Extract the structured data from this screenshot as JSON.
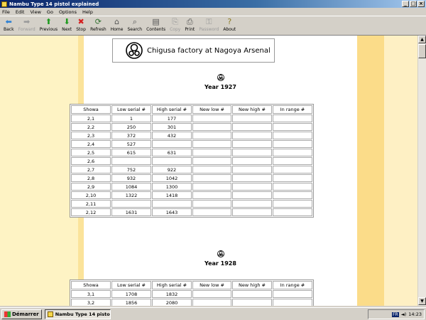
{
  "window": {
    "title": "Nambu Type 14 pistol explained"
  },
  "menu": [
    "File",
    "Edit",
    "View",
    "Go",
    "Options",
    "Help"
  ],
  "toolbar": [
    {
      "label": "Back",
      "icon": "back-arrow-icon",
      "glyph": "⬅",
      "color": "#2a7fd4",
      "enabled": true
    },
    {
      "label": "Forward",
      "icon": "forward-arrow-icon",
      "glyph": "➡",
      "color": "#9a9a9a",
      "enabled": false
    },
    {
      "label": "Previous",
      "icon": "up-arrow-icon",
      "glyph": "⬆",
      "color": "#1e9a1e",
      "enabled": true
    },
    {
      "label": "Next",
      "icon": "down-arrow-icon",
      "glyph": "⬇",
      "color": "#1e9a1e",
      "enabled": true
    },
    {
      "label": "Stop",
      "icon": "stop-icon",
      "glyph": "✖",
      "color": "#d42020",
      "enabled": true
    },
    {
      "label": "Refresh",
      "icon": "refresh-icon",
      "glyph": "⟳",
      "color": "#2f6f2f",
      "enabled": true
    },
    {
      "label": "Home",
      "icon": "home-icon",
      "glyph": "⌂",
      "color": "#555555",
      "enabled": true
    },
    {
      "label": "Search",
      "icon": "search-icon",
      "glyph": "⌕",
      "color": "#555555",
      "enabled": true
    },
    {
      "label": "Contents",
      "icon": "contents-icon",
      "glyph": "▤",
      "color": "#555555",
      "enabled": true
    },
    {
      "label": "Copy",
      "icon": "copy-icon",
      "glyph": "⎘",
      "color": "#9a9a9a",
      "enabled": false
    },
    {
      "label": "Print",
      "icon": "print-icon",
      "glyph": "⎙",
      "color": "#555555",
      "enabled": true
    },
    {
      "label": "Password",
      "icon": "key-icon",
      "glyph": "⚿",
      "color": "#9a9a9a",
      "enabled": false
    },
    {
      "label": "About",
      "icon": "about-icon",
      "glyph": "?",
      "color": "#8a7a20",
      "enabled": true
    }
  ],
  "page": {
    "factory_title": "Chigusa factory at Nagoya Arsenal",
    "columns": [
      "Showa",
      "Low serial #",
      "High serial #",
      "New low #",
      "New high #",
      "In range #"
    ],
    "years": [
      {
        "title": "Year 1927",
        "rows": [
          [
            "2,1",
            "1",
            "177",
            "",
            "",
            ""
          ],
          [
            "2,2",
            "250",
            "301",
            "",
            "",
            ""
          ],
          [
            "2,3",
            "372",
            "432",
            "",
            "",
            ""
          ],
          [
            "2,4",
            "527",
            "",
            "",
            "",
            ""
          ],
          [
            "2,5",
            "615",
            "631",
            "",
            "",
            ""
          ],
          [
            "2,6",
            "",
            "",
            "",
            "",
            ""
          ],
          [
            "2,7",
            "752",
            "922",
            "",
            "",
            ""
          ],
          [
            "2,8",
            "932",
            "1042",
            "",
            "",
            ""
          ],
          [
            "2,9",
            "1084",
            "1300",
            "",
            "",
            ""
          ],
          [
            "2,10",
            "1322",
            "1418",
            "",
            "",
            ""
          ],
          [
            "2,11",
            "",
            "",
            "",
            "",
            ""
          ],
          [
            "2,12",
            "1631",
            "1643",
            "",
            "",
            ""
          ]
        ]
      },
      {
        "title": "Year 1928",
        "rows": [
          [
            "3,1",
            "1708",
            "1832",
            "",
            "",
            ""
          ],
          [
            "3,2",
            "1856",
            "2080",
            "",
            "",
            ""
          ]
        ]
      }
    ]
  },
  "taskbar": {
    "start_label": "Démarrer",
    "task_label": "Nambu Type 14 pistol ...",
    "tray_lang": "FR",
    "clock": "14:23"
  }
}
